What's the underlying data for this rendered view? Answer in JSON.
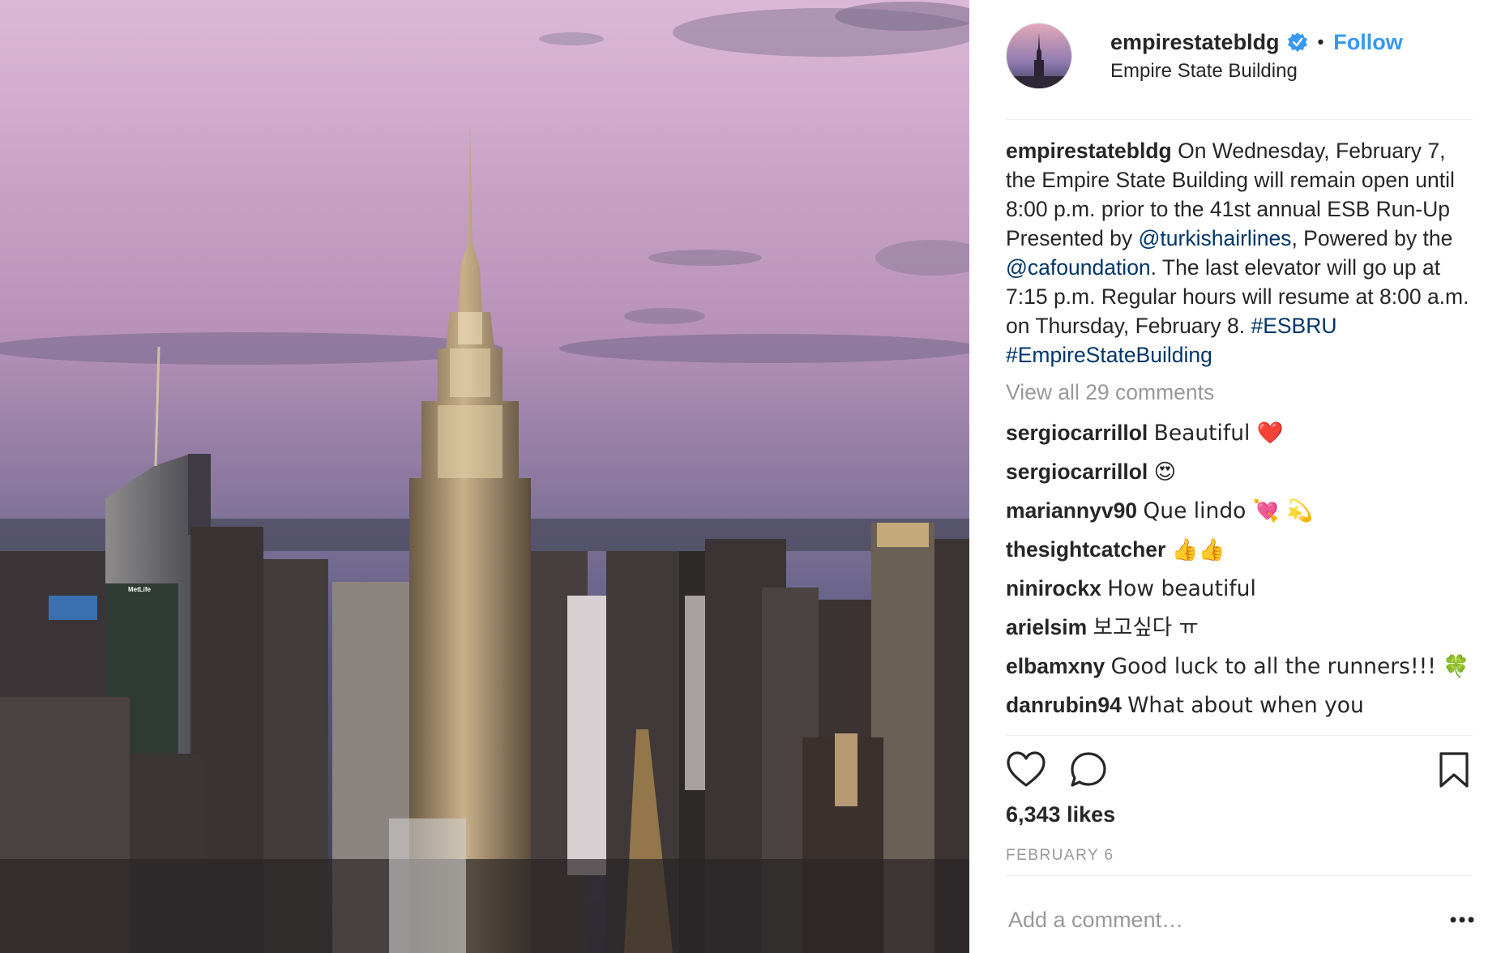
{
  "photo": {
    "alt_semantic": "empire-state-building-skyline",
    "sky_top": "#d9b4d6",
    "sky_bottom": "#5c5a83"
  },
  "header": {
    "username": "empirestatebldg",
    "verified_icon": "verified-badge-icon",
    "separator": "•",
    "follow_label": "Follow",
    "location": "Empire State Building"
  },
  "caption": {
    "username": "empirestatebldg",
    "text_1": "On Wednesday, February 7, the Empire State Building will remain open until 8:00 p.m. prior to the 41st annual ESB Run-Up Presented by ",
    "mention_1": "@turkishairlines",
    "text_2": ", Powered by the ",
    "mention_2": "@cafoundation",
    "text_3": ". The last elevator will go up at 7:15 p.m. Regular hours will resume at 8:00 a.m. on Thursday, February 8. ",
    "hashtag_1": "#ESBRU",
    "hashtag_2": "#EmpireStateBuilding"
  },
  "view_all_comments": "View all 29 comments",
  "comments": [
    {
      "user": "sergiocarrillol",
      "text": "Beautiful ❤️"
    },
    {
      "user": "sergiocarrillol",
      "text": "😍"
    },
    {
      "user": "mariannyv90",
      "text": "Que lindo 💘 💫"
    },
    {
      "user": "thesightcatcher",
      "text": "👍👍"
    },
    {
      "user": "ninirockx",
      "text": "How beautiful"
    },
    {
      "user": "arielsim",
      "text": "보고싶다 ㅠ"
    },
    {
      "user": "elbamxny",
      "text": "Good luck to all the runners!!! 🍀"
    },
    {
      "user": "danrubin94",
      "text": "What about when you"
    }
  ],
  "actions": {
    "like_icon": "heart-icon",
    "comment_icon": "comment-bubble-icon",
    "save_icon": "bookmark-icon"
  },
  "likes": "6,343 likes",
  "date": "FEBRUARY 6",
  "add_comment": {
    "placeholder": "Add a comment…",
    "more_icon": "more-options-icon"
  },
  "colors": {
    "link": "#003569",
    "follow": "#3897f0",
    "muted": "#999999",
    "text": "#262626"
  }
}
